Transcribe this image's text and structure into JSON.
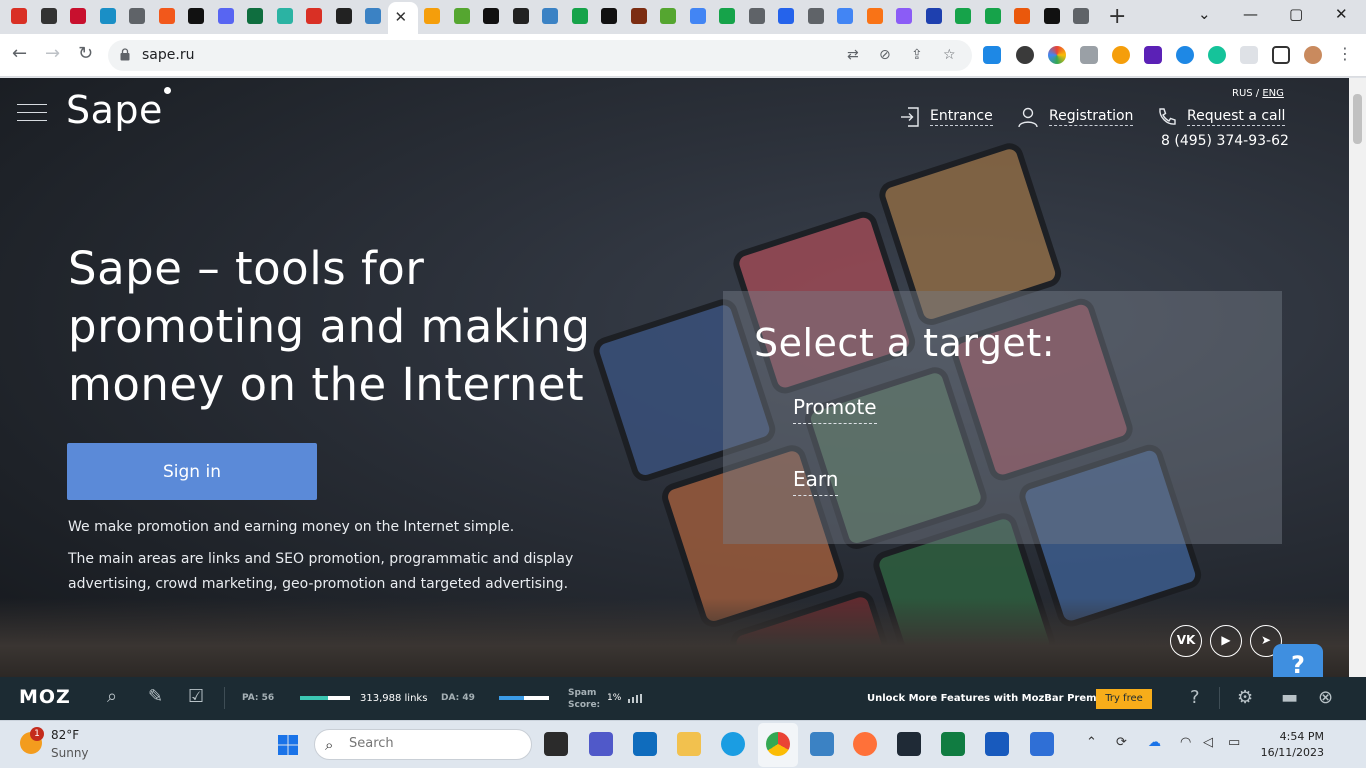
{
  "browser": {
    "url": "sape.ru",
    "window_controls": {
      "minimize": "—",
      "maximize": "▢",
      "close": "✕",
      "tab_search": "⌄"
    },
    "new_tab_label": "+",
    "active_tab_close": "✕",
    "tab_favicon_colors": [
      "#d93025",
      "#333333",
      "#c8102e",
      "#1a8fc6",
      "#5f6368",
      "#f2581b",
      "#111111",
      "#5865f2",
      "#0f6e3f",
      "#2bb3a3",
      "#d93025",
      "#222222",
      "#3b82c4",
      "#ffffff",
      "#f59e0b",
      "#55a630",
      "#111111",
      "#222222",
      "#3b82c4",
      "#16a34a",
      "#111111",
      "#7c2d12",
      "#55a630",
      "#4285f4",
      "#16a34a",
      "#5f6368",
      "#2563eb",
      "#5f6368",
      "#4285f4",
      "#f97316",
      "#8b5cf6",
      "#1e40af",
      "#16a34a",
      "#16a34a",
      "#ea580c",
      "#111111",
      "#5f6368"
    ]
  },
  "site": {
    "logo": "Sape",
    "lang": {
      "rus": "RUS",
      "sep": " / ",
      "eng": "ENG"
    },
    "header_links": {
      "entrance": "Entrance",
      "registration": "Registration",
      "request_call": "Request a call"
    },
    "phone": "8 (495) 374-93-62",
    "hero_title": "Sape – tools for promoting and making money on the Internet",
    "sign_in": "Sign in",
    "desc1": "We make promotion and earning money on the Internet simple.",
    "desc2": "The main areas are links and SEO promotion, programmatic and display advertising, crowd marketing, geo-promotion and targeted advertising.",
    "target_title": "Select a target:",
    "target_promote": "Promote",
    "target_earn": "Earn",
    "social": {
      "vk": "VK",
      "youtube": "▶",
      "telegram": "➤"
    },
    "help": "?",
    "accent": "#5b8ad8"
  },
  "mozbar": {
    "logo": "MOZ",
    "pa_label": "PA: 56",
    "pa_fraction": 0.56,
    "links": "313,988 links",
    "da_label": "DA: 49",
    "da_fraction": 0.49,
    "spam_label": "Spam Score:",
    "spam_value": "1%",
    "promo": "Unlock More Features with MozBar Premium",
    "try_free": "Try free",
    "help": "?"
  },
  "taskbar": {
    "weather_badge": "1",
    "temperature": "82°F",
    "condition": "Sunny",
    "search_placeholder": "Search",
    "time": "4:54 PM",
    "date": "16/11/2023"
  }
}
